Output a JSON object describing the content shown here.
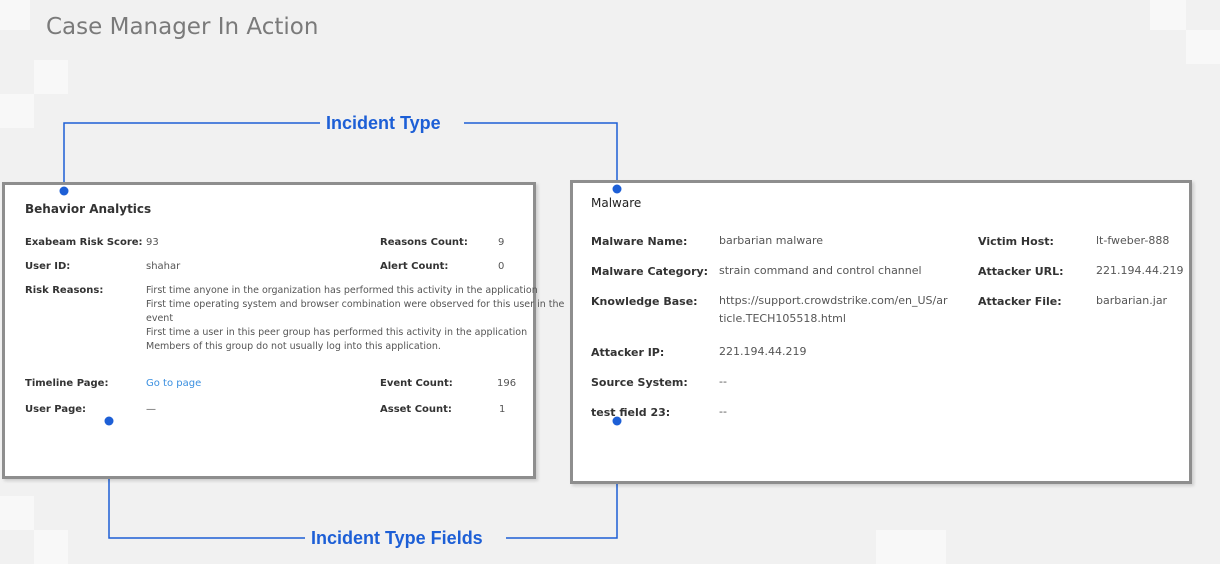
{
  "page": {
    "title": "Case Manager In Action"
  },
  "callouts": {
    "incident_type": "Incident Type",
    "incident_type_fields": "Incident Type Fields"
  },
  "colors": {
    "accent": "#1d5fd6",
    "link": "#3a8fe0"
  },
  "behavior_panel": {
    "title": "Behavior Analytics",
    "risk_score_label": "Exabeam Risk Score:",
    "risk_score_value": "93",
    "reasons_count_label": "Reasons Count:",
    "reasons_count_value": "9",
    "user_id_label": "User ID:",
    "user_id_value": "shahar",
    "alert_count_label": "Alert Count:",
    "alert_count_value": "0",
    "risk_reasons_label": "Risk Reasons:",
    "risk_reasons": [
      "First time anyone in the organization has performed this activity in the application",
      "First time operating system and browser combination were observed for this user in the",
      "event",
      "First time a user in this peer group has performed this activity in the application",
      "Members of this group do not usually log into this application."
    ],
    "timeline_label": "Timeline Page:",
    "timeline_link": "Go to page",
    "event_count_label": "Event Count:",
    "event_count_value": "196",
    "user_page_label": "User Page:",
    "user_page_value": "—",
    "asset_count_label": "Asset Count:",
    "asset_count_value": "1"
  },
  "malware_panel": {
    "title": "Malware",
    "name_label": "Malware Name:",
    "name_value": "barbarian malware",
    "victim_host_label": "Victim Host:",
    "victim_host_value": "lt-fweber-888",
    "category_label": "Malware Category:",
    "category_value": "strain command and control channel",
    "attacker_url_label": "Attacker URL:",
    "attacker_url_value": "221.194.44.219",
    "kb_label": "Knowledge Base:",
    "kb_value_line1": "https://support.crowdstrike.com/en_US/ar",
    "kb_value_line2": "ticle.TECH105518.html",
    "attacker_file_label": "Attacker File:",
    "attacker_file_value": "barbarian.jar",
    "attacker_ip_label": "Attacker IP:",
    "attacker_ip_value": "221.194.44.219",
    "source_system_label": "Source System:",
    "source_system_value": "--",
    "test_field_label": "test field 23:",
    "test_field_value": "--"
  }
}
